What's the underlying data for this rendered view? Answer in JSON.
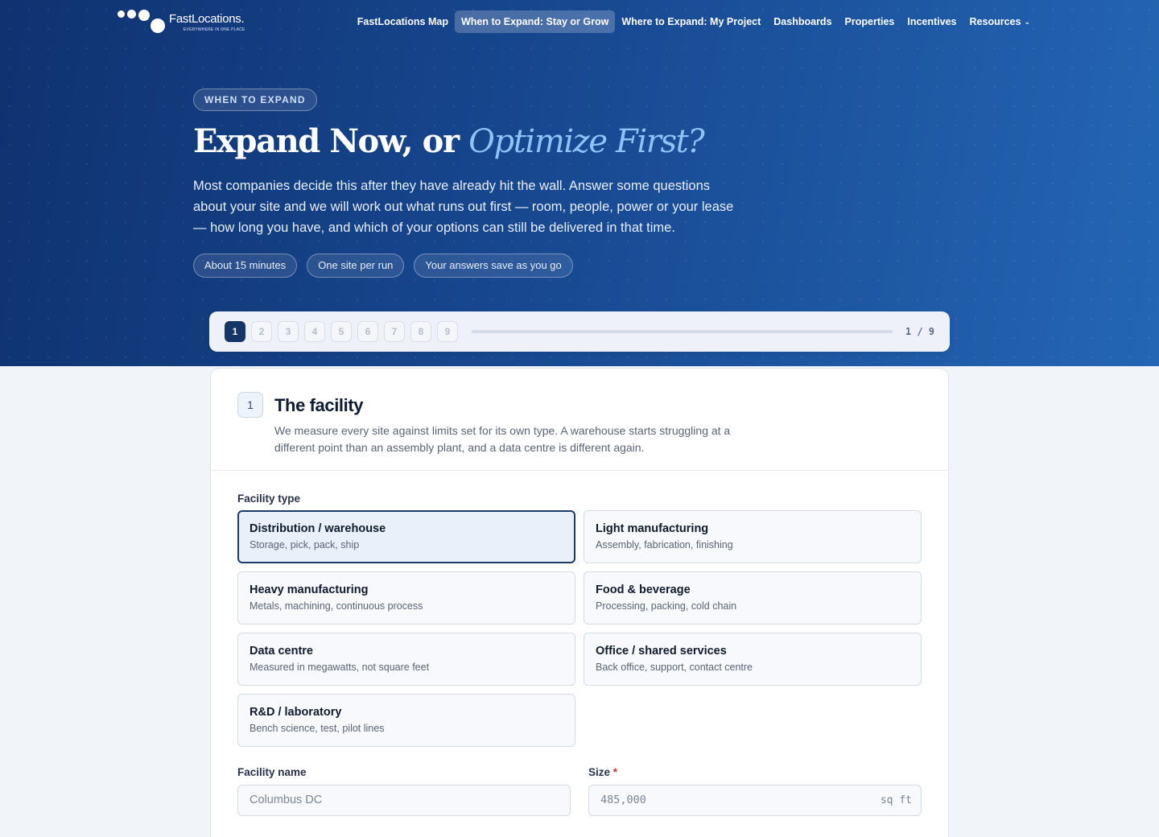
{
  "brand": {
    "name": "FastLocations",
    "mark": ".",
    "tagline": "EVERYWHERE IN ONE PLACE"
  },
  "nav": {
    "items": [
      {
        "label": "FastLocations Map",
        "active": false
      },
      {
        "label": "When to Expand: Stay or Grow",
        "active": true
      },
      {
        "label": "Where to Expand: My Project",
        "active": false
      },
      {
        "label": "Dashboards",
        "active": false
      },
      {
        "label": "Properties",
        "active": false
      },
      {
        "label": "Incentives",
        "active": false
      },
      {
        "label": "Resources",
        "active": false
      }
    ],
    "resources_icon": "chevron-down-icon"
  },
  "hero": {
    "eyebrow": "WHEN TO EXPAND",
    "title_main": "Expand Now, or ",
    "title_accent": "Optimize First?",
    "lede": "Most companies decide this after they have already hit the wall. Answer some questions about your site and we will work out what runs out first — room, people, power or your lease — how long you have, and which of your options can still be delivered in that time.",
    "pills": [
      "About 15 minutes",
      "One site per run",
      "Your answers save as you go"
    ]
  },
  "stepper": {
    "steps": [
      "1",
      "2",
      "3",
      "4",
      "5",
      "6",
      "7",
      "8",
      "9"
    ],
    "current": 1,
    "total": 9,
    "counter": "1 / 9",
    "progress": 0
  },
  "section": {
    "number": "1",
    "title": "The facility",
    "description": "We measure every site against limits set for its own type. A warehouse starts struggling at a different point than an assembly plant, and a data centre is different again."
  },
  "facility_type": {
    "label": "Facility type",
    "selected": "Distribution / warehouse",
    "options": [
      {
        "title": "Distribution / warehouse",
        "subtitle": "Storage, pick, pack, ship"
      },
      {
        "title": "Light manufacturing",
        "subtitle": "Assembly, fabrication, finishing"
      },
      {
        "title": "Heavy manufacturing",
        "subtitle": "Metals, machining, continuous process"
      },
      {
        "title": "Food & beverage",
        "subtitle": "Processing, packing, cold chain"
      },
      {
        "title": "Data centre",
        "subtitle": "Measured in megawatts, not square feet"
      },
      {
        "title": "Office / shared services",
        "subtitle": "Back office, support, contact centre"
      },
      {
        "title": "R&D / laboratory",
        "subtitle": "Bench science, test, pilot lines"
      }
    ]
  },
  "facility_name": {
    "label": "Facility name",
    "placeholder": "Columbus DC",
    "value": ""
  },
  "size": {
    "label": "Size",
    "required_mark": "*",
    "placeholder": "485,000",
    "value": "",
    "unit": "sq ft"
  },
  "colors": {
    "hero_dark": "#0f3270",
    "hero_light": "#2466b4",
    "accent_text": "#8dc3f7",
    "selected_border": "#1c3a6b",
    "step_current": "#163567",
    "required": "#c0392b"
  }
}
